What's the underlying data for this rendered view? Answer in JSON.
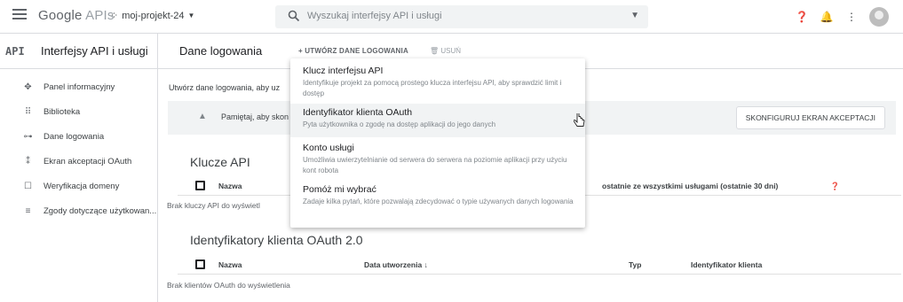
{
  "topbar": {
    "logo_main": "Google",
    "logo_sub": "APIs",
    "project_name": "moj-projekt-24",
    "search_placeholder": "Wyszukaj interfejsy API i usługi"
  },
  "sidebar": {
    "mark": "API",
    "title": "Interfejsy API i usługi",
    "items": [
      {
        "label": "Panel informacyjny",
        "icon": "dashboard-icon",
        "glyph": "✥"
      },
      {
        "label": "Biblioteka",
        "icon": "library-icon",
        "glyph": "⠿"
      },
      {
        "label": "Dane logowania",
        "icon": "key-icon",
        "glyph": "⊶"
      },
      {
        "label": "Ekran akceptacji OAuth",
        "icon": "consent-icon",
        "glyph": "⁑"
      },
      {
        "label": "Weryfikacja domeny",
        "icon": "domain-icon",
        "glyph": "☐"
      },
      {
        "label": "Zgody dotyczące użytkowan...",
        "icon": "agreements-icon",
        "glyph": "≡"
      }
    ]
  },
  "main": {
    "page_title": "Dane logowania",
    "create_label": "+ UTWÓRZ DANE LOGOWANIA",
    "delete_label": "USUŃ",
    "intro_text": "Utwórz dane logowania, aby uz",
    "banner_text": "Pamiętaj, aby skon",
    "configure_button": "SKONFIGURUJ EKRAN AKCEPTACJI",
    "api_keys": {
      "title": "Klucze API",
      "col_name": "Nazwa",
      "col_usage": "ostatnie ze wszystkimi usługami (ostatnie 30 dni)",
      "empty": "Brak kluczy API do wyświetl"
    },
    "oauth": {
      "title": "Identyfikatory klienta OAuth 2.0",
      "col_name": "Nazwa",
      "col_created": "Data utworzenia",
      "col_type": "Typ",
      "col_client": "Identyfikator klienta",
      "empty": "Brak klientów OAuth do wyświetlenia"
    }
  },
  "menu": {
    "items": [
      {
        "title": "Klucz interfejsu API",
        "desc": "Identyfikuje projekt za pomocą prostego klucza interfejsu API, aby sprawdzić limit i dostęp"
      },
      {
        "title": "Identyfikator klienta OAuth",
        "desc": "Pyta użytkownika o zgodę na dostęp aplikacji do jego danych"
      },
      {
        "title": "Konto usługi",
        "desc": "Umożliwia uwierzytelnianie od serwera do serwera na poziomie aplikacji przy użyciu kont robota"
      },
      {
        "title": "Pomóż mi wybrać",
        "desc": "Zadaje kilka pytań, które pozwalają zdecydować o typie używanych danych logowania"
      }
    ]
  }
}
